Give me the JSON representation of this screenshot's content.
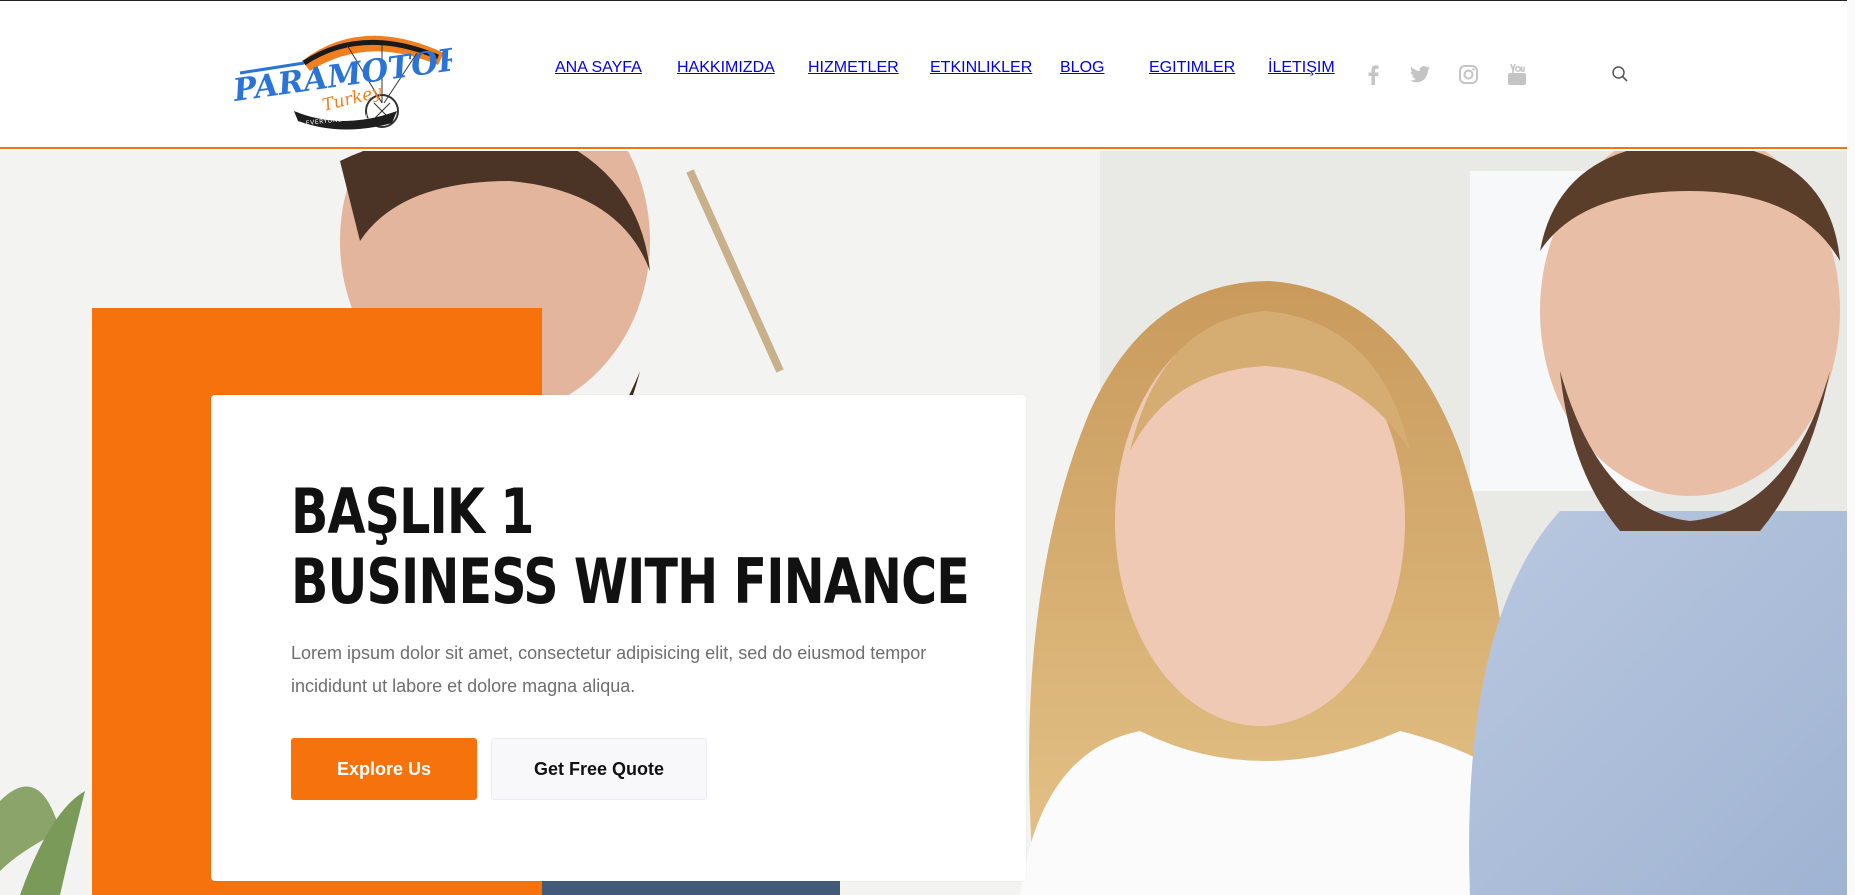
{
  "brand": {
    "logo_text": "PARAMOTOR",
    "logo_script": "Turkey",
    "logo_ribbon": "EVERYONE CAN FLY!"
  },
  "nav": {
    "items": [
      {
        "label": "ANA SAYFA",
        "active": true
      },
      {
        "label": "HAKKIMIZDA",
        "active": false
      },
      {
        "label": "HIZMETLER",
        "active": false
      },
      {
        "label": "ETKINLIKLER",
        "active": false
      },
      {
        "label": "BLOG",
        "active": false
      },
      {
        "label": "EGITIMLER",
        "active": false
      },
      {
        "label": "İLETIŞIM",
        "active": false
      }
    ]
  },
  "social": [
    "facebook-icon",
    "twitter-icon",
    "instagram-icon",
    "youtube-icon"
  ],
  "hero": {
    "title_line1": "BAŞLIK 1",
    "title_line2": "BUSINESS WITH FINANCE",
    "text": "Lorem ipsum dolor sit amet, consectetur adipisicing elit, sed do eiusmod tempor incididunt ut labore et dolore magna aliqua.",
    "primary_button": "Explore Us",
    "secondary_button": "Get Free Quote"
  },
  "colors": {
    "accent": "#f5720d",
    "text_dark": "#111111",
    "text_muted": "#6e6e6e"
  }
}
